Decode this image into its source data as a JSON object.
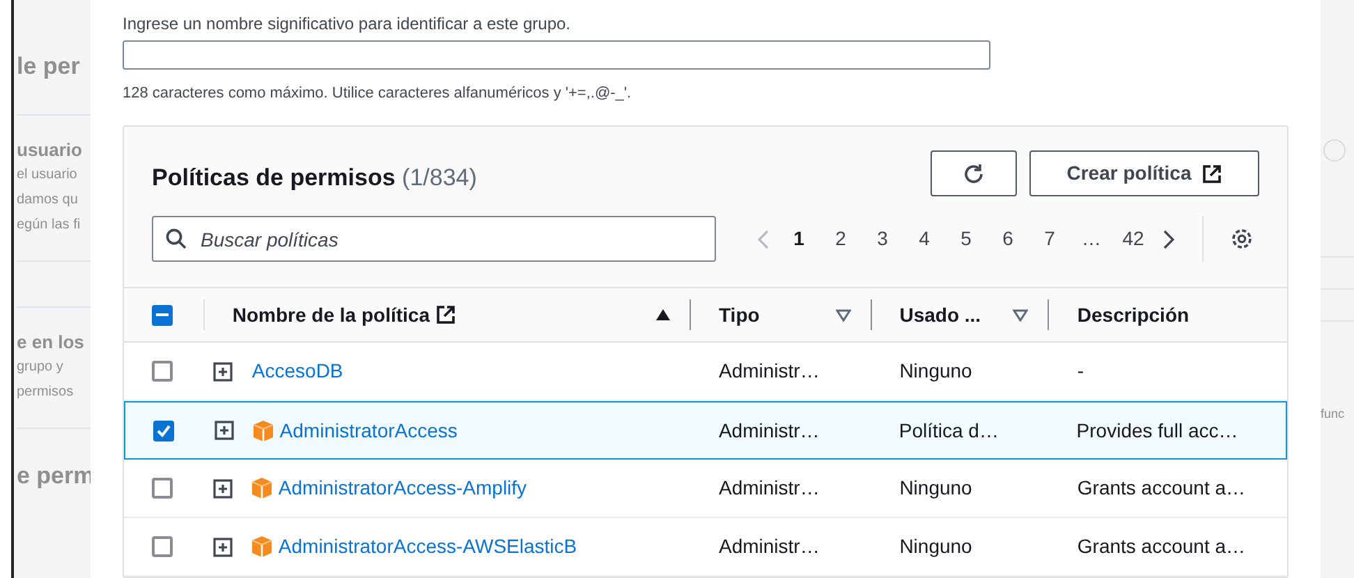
{
  "background": {
    "left_fragments": [
      {
        "text": "le per",
        "kind": "heading"
      },
      {
        "kind": "divider"
      },
      {
        "text": "usuario",
        "kind": "label"
      },
      {
        "text": "el usuario",
        "kind": "body"
      },
      {
        "text": "damos qu",
        "kind": "body"
      },
      {
        "text": "egún las fi",
        "kind": "body"
      },
      {
        "kind": "divider"
      },
      {
        "kind": "divider"
      },
      {
        "text": "e en los",
        "kind": "label"
      },
      {
        "text": "grupo y",
        "kind": "body"
      },
      {
        "text": "permisos",
        "kind": "body"
      },
      {
        "kind": "divider"
      },
      {
        "text": "e perm",
        "kind": "heading"
      }
    ],
    "right_fragments": [
      {
        "text": "func"
      }
    ]
  },
  "name_field": {
    "description": "Ingrese un nombre significativo para identificar a este grupo.",
    "constraint": "128 caracteres como máximo. Utilice caracteres alfanuméricos y '+=,.@-_'."
  },
  "policies": {
    "title": "Políticas de permisos",
    "count": "(1/834)",
    "create_button": "Crear política",
    "search": {
      "placeholder": "Buscar políticas"
    },
    "pagination": {
      "prev_disabled": true,
      "next_disabled": false,
      "pages": [
        {
          "label": "1",
          "selected": true
        },
        {
          "label": "2",
          "selected": false
        },
        {
          "label": "3",
          "selected": false
        },
        {
          "label": "4",
          "selected": false
        },
        {
          "label": "5",
          "selected": false
        },
        {
          "label": "6",
          "selected": false
        },
        {
          "label": "7",
          "selected": false
        },
        {
          "label": "…",
          "selected": false
        },
        {
          "label": "42",
          "selected": false
        }
      ]
    },
    "select_all": {
      "indeterminate": true
    },
    "columns": [
      {
        "label": "Nombre de la política",
        "kind": "sorted_ascending",
        "external_link": true
      },
      {
        "label": "Tipo",
        "kind": "sortable",
        "external_link": false
      },
      {
        "label": "Usado ...",
        "kind": "sortable",
        "external_link": false
      },
      {
        "label": "Descripción",
        "kind": "plain",
        "external_link": false
      }
    ],
    "rows": [
      {
        "selected": false,
        "kind": "customer",
        "name": "AccesoDB",
        "type": "Administr…",
        "used_as": "Ninguno",
        "description": "-"
      },
      {
        "selected": true,
        "kind": "aws",
        "name": "AdministratorAccess",
        "type": "Administr…",
        "used_as": "Política d…",
        "description": "Provides full acc…"
      },
      {
        "selected": false,
        "kind": "aws",
        "name": "AdministratorAccess-Amplify",
        "type": "Administr…",
        "used_as": "Ninguno",
        "description": "Grants account a…"
      },
      {
        "selected": false,
        "kind": "aws",
        "name": "AdministratorAccess-AWSElasticB",
        "type": "Administr…",
        "used_as": "Ninguno",
        "description": "Grants account a…"
      }
    ]
  }
}
